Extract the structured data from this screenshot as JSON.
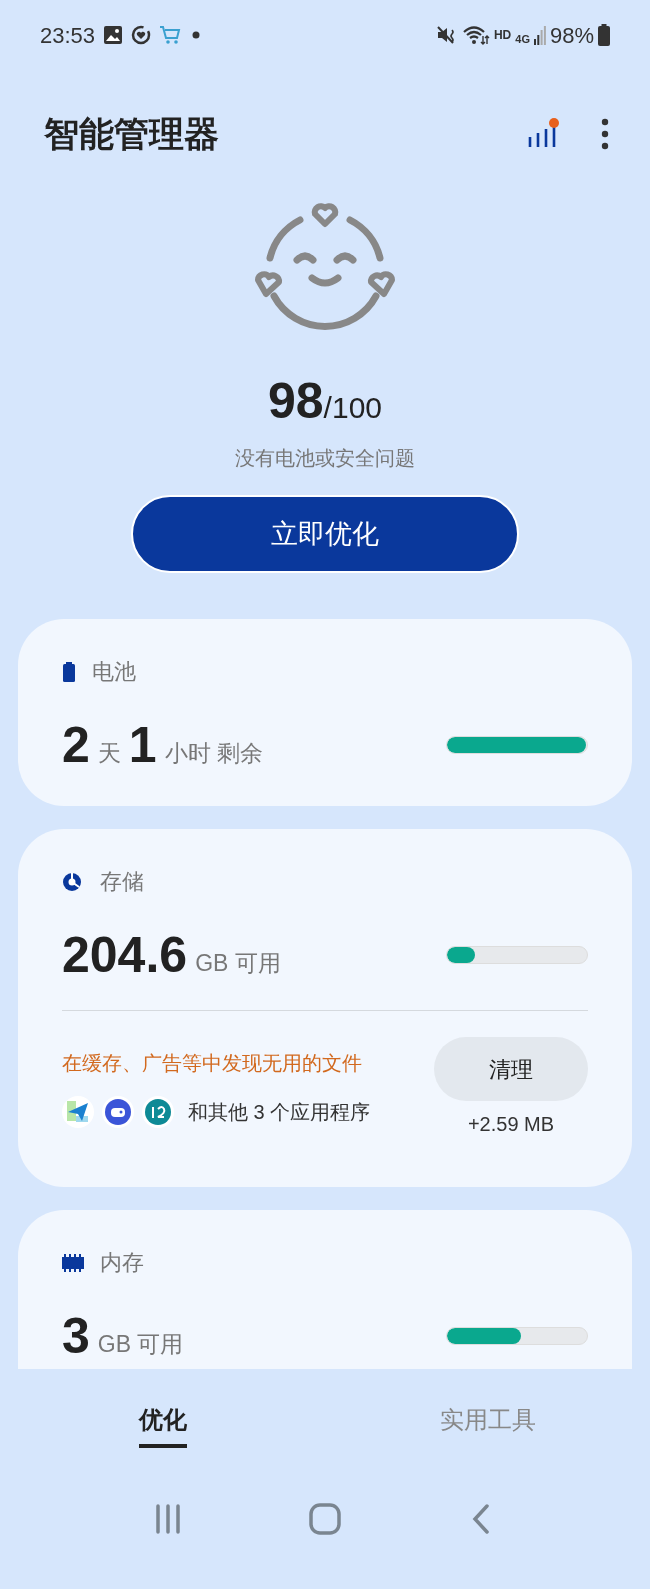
{
  "status_bar": {
    "time": "23:53",
    "network_labels": [
      "HD",
      "4G"
    ],
    "battery": "98%"
  },
  "header": {
    "title": "智能管理器"
  },
  "score": {
    "value": "98",
    "max": "/100",
    "message": "没有电池或安全问题"
  },
  "optimize_button": "立即优化",
  "cards": [
    {
      "kind": "battery",
      "title": "电池",
      "level": 0.99,
      "reading": [
        {
          "text": "2",
          "kind": "number"
        },
        {
          "text": "天",
          "kind": "unit"
        },
        {
          "text": "1",
          "kind": "number"
        },
        {
          "text": "小时 剩余",
          "kind": "unit"
        }
      ]
    },
    {
      "kind": "storage",
      "title": "存储",
      "level": 0.2,
      "reading": [
        {
          "text": "204.6",
          "kind": "number"
        },
        {
          "text": "GB 可用",
          "kind": "unit"
        }
      ],
      "cleanup": {
        "message": "在缓存、广告等中发现无用的文件",
        "apps_text": "和其他 3 个应用程序",
        "button": "清理",
        "size": "+2.59 MB"
      }
    },
    {
      "kind": "memory",
      "title": "内存",
      "level": 0.53,
      "reading": [
        {
          "text": "3",
          "kind": "number"
        },
        {
          "text": "GB 可用",
          "kind": "unit"
        }
      ]
    }
  ],
  "tabs": [
    {
      "label": "优化",
      "selected": true
    },
    {
      "label": "实用工具",
      "selected": false
    }
  ]
}
